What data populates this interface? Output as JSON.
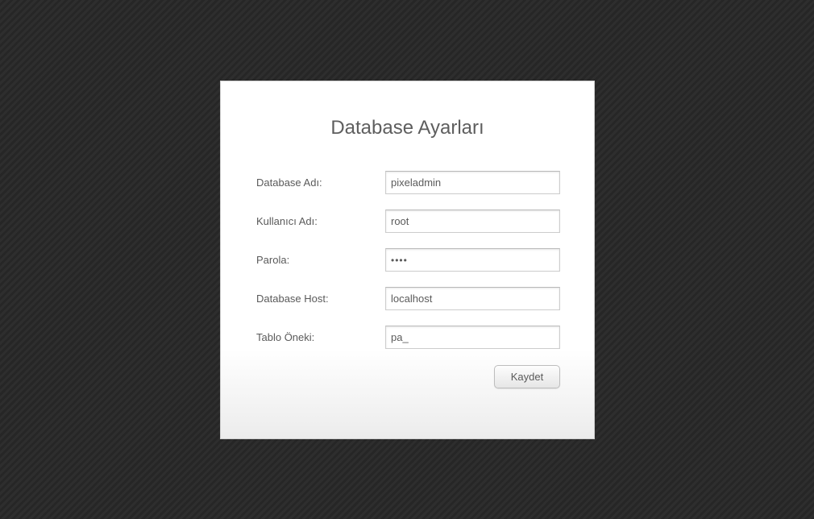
{
  "form": {
    "title": "Database Ayarları",
    "fields": [
      {
        "label": "Database Adı:",
        "value": "pixeladmin",
        "type": "text"
      },
      {
        "label": "Kullanıcı Adı:",
        "value": "root",
        "type": "text"
      },
      {
        "label": "Parola:",
        "value": "••••",
        "type": "password"
      },
      {
        "label": "Database Host:",
        "value": "localhost",
        "type": "text"
      },
      {
        "label": "Tablo Öneki:",
        "value": "pa_",
        "type": "text"
      }
    ],
    "save_label": "Kaydet"
  },
  "colors": {
    "background": "#2b2b2b",
    "panel": "#ffffff",
    "text": "#5a5a5a"
  }
}
